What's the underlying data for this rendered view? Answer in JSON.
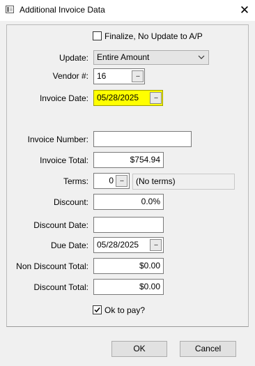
{
  "window": {
    "title": "Additional Invoice Data",
    "close_glyph": "✕"
  },
  "finalize": {
    "label": "Finalize, No Update to A/P",
    "checked": false
  },
  "update": {
    "label": "Update:",
    "value": "Entire Amount"
  },
  "vendor": {
    "label": "Vendor #:",
    "value": "16",
    "lookup": "..."
  },
  "invoice_date": {
    "label": "Invoice Date:",
    "value": "05/28/2025",
    "lookup": "...",
    "highlight": "#ffff00"
  },
  "invoice_number": {
    "label": "Invoice Number:",
    "value": ""
  },
  "invoice_total": {
    "label": "Invoice Total:",
    "value": "$754.94"
  },
  "terms": {
    "label": "Terms:",
    "value": "0",
    "lookup": "...",
    "description": "(No terms)"
  },
  "discount": {
    "label": "Discount:",
    "value": "0.0%"
  },
  "discount_date": {
    "label": "Discount Date:",
    "value": ""
  },
  "due_date": {
    "label": "Due Date:",
    "value": "05/28/2025",
    "lookup": "..."
  },
  "non_discount_total": {
    "label": "Non Discount Total:",
    "value": "$0.00"
  },
  "discount_total": {
    "label": "Discount Total:",
    "value": "$0.00"
  },
  "ok_to_pay": {
    "label": "Ok to pay?",
    "checked": true
  },
  "buttons": {
    "ok": "OK",
    "cancel": "Cancel"
  }
}
